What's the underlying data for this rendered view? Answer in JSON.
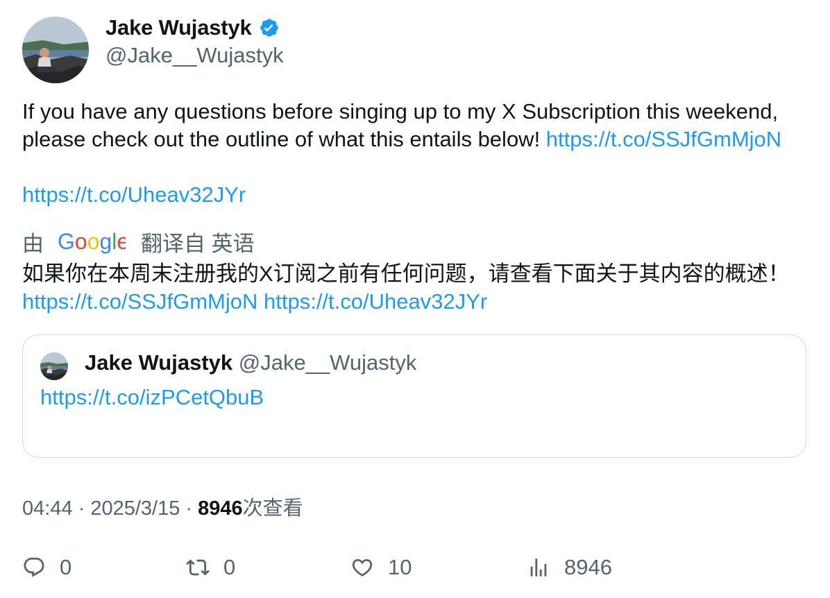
{
  "author": {
    "display_name": "Jake Wujastyk",
    "handle": "@Jake__Wujastyk",
    "verified": true
  },
  "tweet": {
    "text_line": "If you have any questions before singing up to my X Subscription this weekend, please check out the outline of what this entails below! ",
    "link_1": "https://t.co/SSJfGmMjoN",
    "link_2": "https://t.co/Uheav32JYr"
  },
  "translation": {
    "by_label": "由",
    "provider": "Google",
    "from_label": "翻译自 英语",
    "text": "如果你在本周末注册我的X订阅之前有任何问题，请查看下面关于其内容的概述！ ",
    "link_1": "https://t.co/SSJfGmMjoN",
    "link_2": "https://t.co/Uheav32JYr"
  },
  "quote": {
    "display_name": "Jake Wujastyk",
    "handle": "@Jake__Wujastyk",
    "link": "https://t.co/izPCetQbuB"
  },
  "meta": {
    "time": "04:44",
    "separator": " · ",
    "date": "2025/3/15",
    "views_count": "8946",
    "views_label": "次查看"
  },
  "actions": {
    "replies": "0",
    "retweets": "0",
    "likes": "10",
    "views": "8946"
  },
  "colors": {
    "link": "#1d9bf0",
    "text": "#0f1419",
    "secondary": "#536471",
    "border": "#cfd9de",
    "verified": "#1d9bf0"
  }
}
